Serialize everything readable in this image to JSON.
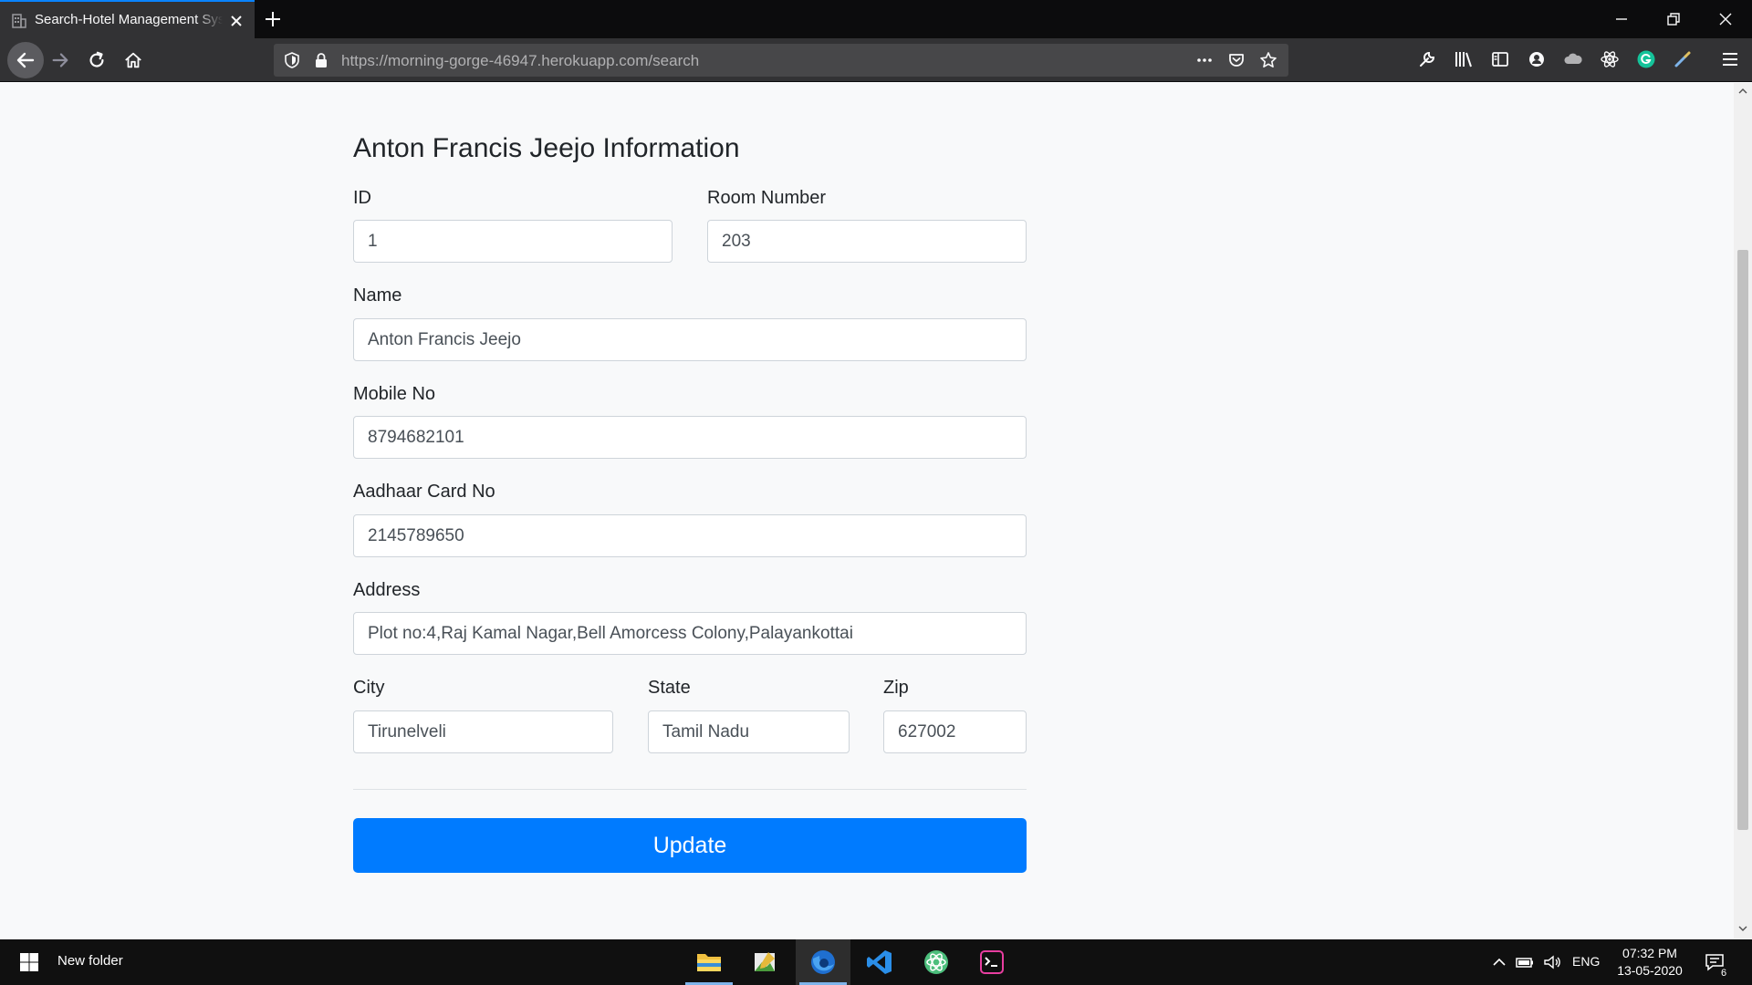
{
  "browser": {
    "tab_title": "Search-Hotel Management System",
    "url_host": "https://morning-gorge-46947.herokuapp.com",
    "url_path": "/search"
  },
  "form": {
    "title": "Anton Francis Jeejo Information",
    "id": {
      "label": "ID",
      "value": "1"
    },
    "room_number": {
      "label": "Room Number",
      "value": "203"
    },
    "name": {
      "label": "Name",
      "value": "Anton Francis Jeejo"
    },
    "mobile": {
      "label": "Mobile No",
      "value": "8794682101"
    },
    "aadhaar": {
      "label": "Aadhaar Card No",
      "value": "2145789650"
    },
    "address": {
      "label": "Address",
      "value": "Plot no:4,Raj Kamal Nagar,Bell Amorcess Colony,Palayankottai"
    },
    "city": {
      "label": "City",
      "value": "Tirunelveli"
    },
    "state": {
      "label": "State",
      "value": "Tamil Nadu"
    },
    "zip": {
      "label": "Zip",
      "value": "627002"
    },
    "submit_label": "Update",
    "accent_color": "#007bff"
  },
  "taskbar": {
    "search_text": "New folder",
    "language": "ENG",
    "time": "07:32 PM",
    "date": "13-05-2020",
    "notification_count": "6"
  }
}
